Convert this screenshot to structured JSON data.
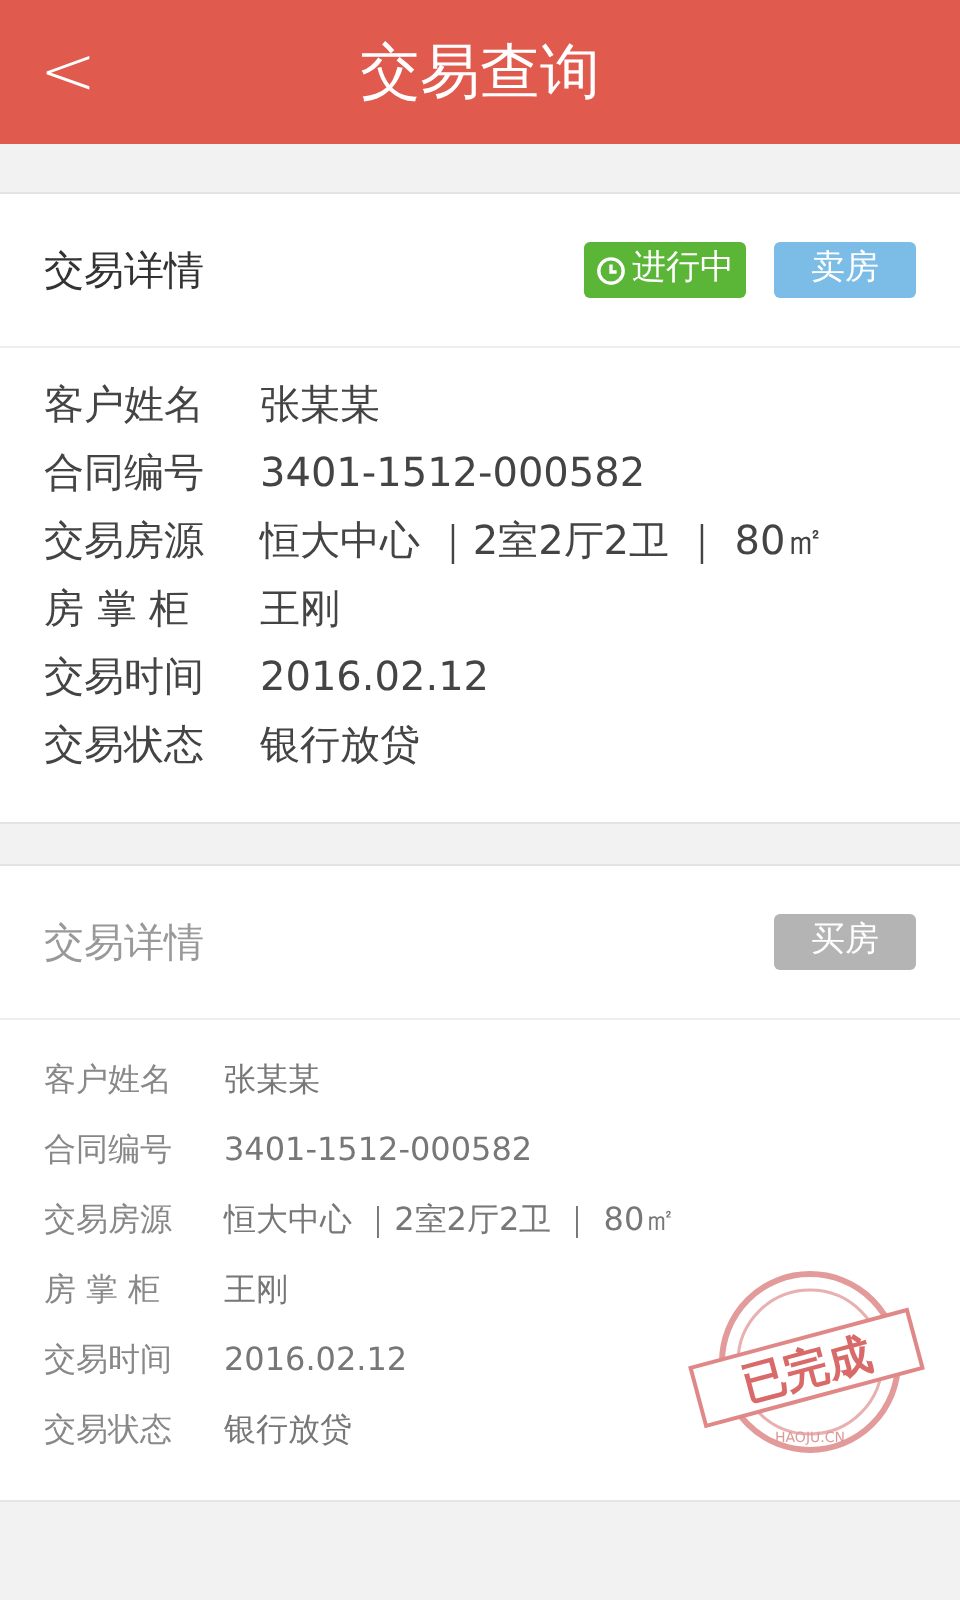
{
  "header": {
    "back_icon": "<",
    "title": "交易查询"
  },
  "cards": [
    {
      "title": "交易详情",
      "active": true,
      "status": {
        "label": "进行中"
      },
      "type_tag": "卖房",
      "rows": [
        {
          "label": "客户姓名",
          "value": "张某某"
        },
        {
          "label": "合同编号",
          "value": "3401-1512-000582"
        },
        {
          "label": "交易房源",
          "value": "恒大中心 ｜2室2厅2卫 ｜ 80㎡"
        },
        {
          "label": "房 掌 柜",
          "value": "王刚"
        },
        {
          "label": "交易时间",
          "value": "2016.02.12"
        },
        {
          "label": "交易状态",
          "value": "银行放贷"
        }
      ]
    },
    {
      "title": "交易详情",
      "active": false,
      "type_tag": "买房",
      "stamp": {
        "label": "已完成",
        "url": "HAOJU.CN"
      },
      "rows": [
        {
          "label": "客户姓名",
          "value": "张某某"
        },
        {
          "label": "合同编号",
          "value": "3401-1512-000582"
        },
        {
          "label": "交易房源",
          "value": "恒大中心 ｜2室2厅2卫 ｜ 80㎡"
        },
        {
          "label": "房 掌 柜",
          "value": "王刚"
        },
        {
          "label": "交易时间",
          "value": "2016.02.12"
        },
        {
          "label": "交易状态",
          "value": "银行放贷"
        }
      ]
    }
  ]
}
